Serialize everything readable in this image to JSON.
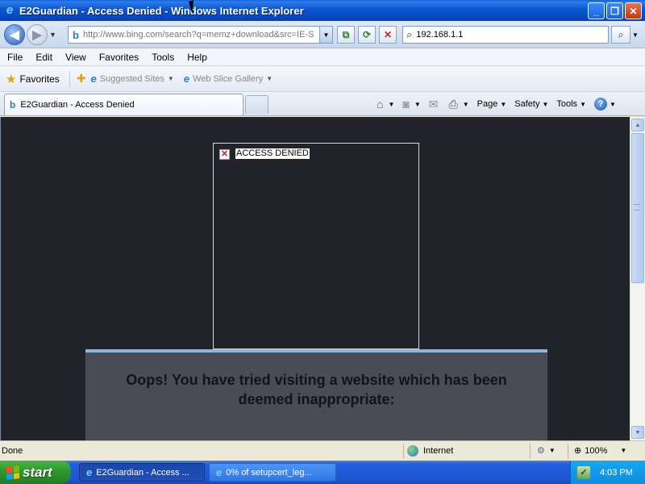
{
  "window": {
    "title": "E2Guardian - Access Denied - Windows Internet Explorer",
    "minimize": "_",
    "maximize": "❐",
    "close": "✕"
  },
  "address_bar": {
    "url": "http://www.bing.com/search?q=memz+download&src=IE-S",
    "search_value": "192.168.1.1"
  },
  "menu": [
    "File",
    "Edit",
    "View",
    "Favorites",
    "Tools",
    "Help"
  ],
  "favorites_bar": {
    "favorites_label": "Favorites",
    "items": [
      {
        "label": "Suggested Sites",
        "icon": "ie-icon"
      },
      {
        "label": "Web Slice Gallery",
        "icon": "ie-icon"
      }
    ]
  },
  "tabs": [
    {
      "label": "E2Guardian - Access Denied",
      "icon": "bing-icon"
    }
  ],
  "command_bar": {
    "page": "Page",
    "safety": "Safety",
    "tools": "Tools"
  },
  "content": {
    "image_alt": "ACCESS DENIED",
    "message": "Oops! You have tried visiting a website which has been deemed inappropriate:"
  },
  "status_bar": {
    "status": "Done",
    "zone": "Internet",
    "zoom": "100%"
  },
  "taskbar": {
    "start": "start",
    "buttons": [
      {
        "label": "E2Guardian - Access ...",
        "active": true,
        "icon": "ie-icon"
      },
      {
        "label": "0% of setupcert_leg...",
        "active": false,
        "icon": "ie-icon"
      }
    ],
    "clock": "4:03 PM"
  },
  "colors": {
    "page_background": "#22232b",
    "panel_background": "#4a4b57",
    "panel_accent": "#8db6de",
    "titlebar": "#0a56d0",
    "taskbar": "#245edb",
    "start_button": "#2f9a2f"
  }
}
